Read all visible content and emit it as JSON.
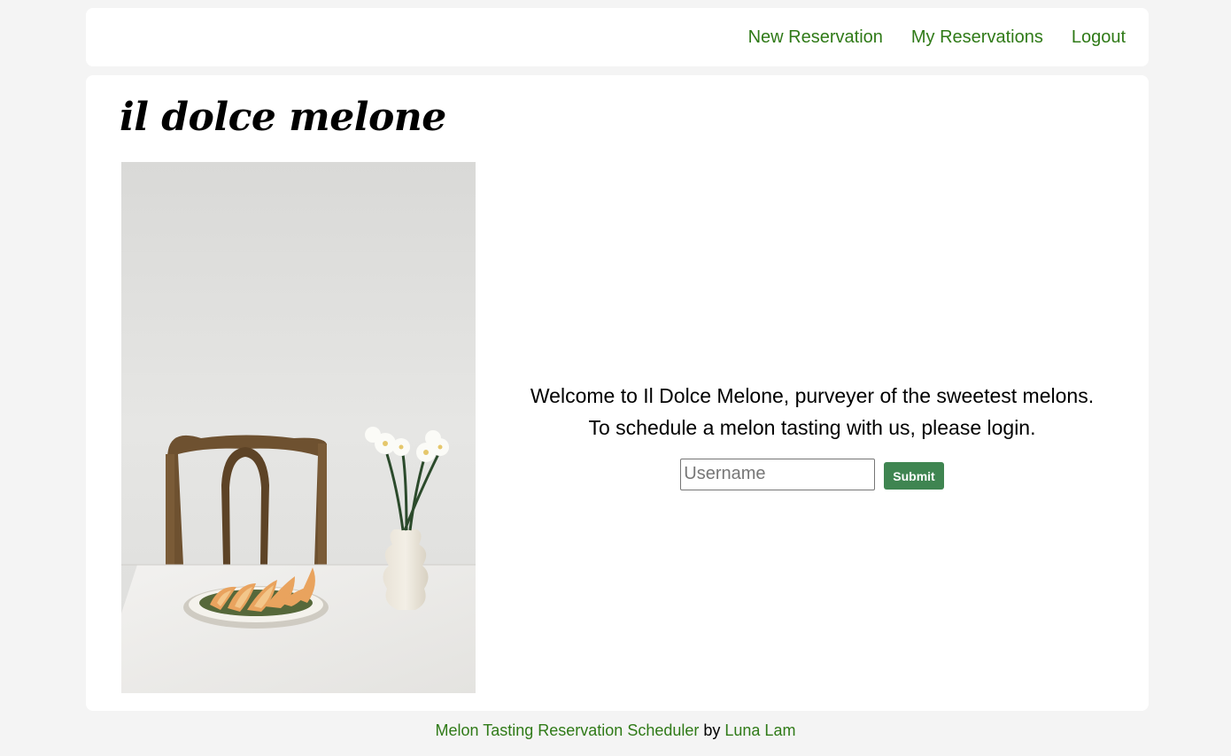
{
  "nav": {
    "links": [
      {
        "label": "New Reservation"
      },
      {
        "label": "My Reservations"
      },
      {
        "label": "Logout"
      }
    ]
  },
  "brand": {
    "title": "il dolce melone"
  },
  "hero": {
    "image_name": "melon-table-photo"
  },
  "welcome": {
    "line1": "Welcome to Il Dolce Melone, purveyer of the sweetest melons.",
    "line2": "To schedule a melon tasting with us, please login."
  },
  "login": {
    "username_placeholder": "Username",
    "username_value": "",
    "submit_label": "Submit"
  },
  "footer": {
    "app_link": "Melon Tasting Reservation Scheduler",
    "by_text": " by ",
    "author_link": "Luna Lam"
  },
  "colors": {
    "link_green": "#2f7a17",
    "button_green": "#3f8551",
    "page_bg": "#f4f4f4"
  }
}
